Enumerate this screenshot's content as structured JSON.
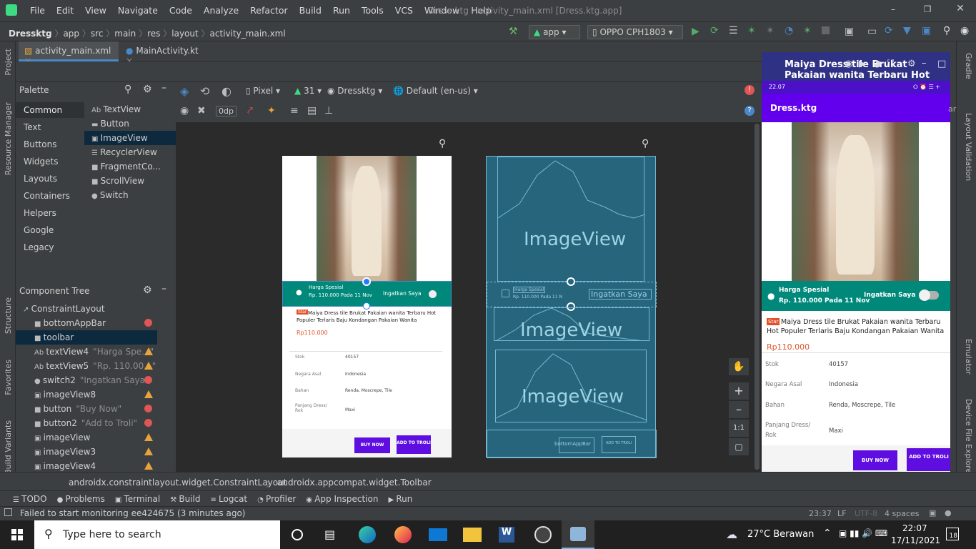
{
  "menu": [
    "File",
    "Edit",
    "View",
    "Navigate",
    "Code",
    "Analyze",
    "Refactor",
    "Build",
    "Run",
    "Tools",
    "VCS",
    "Window",
    "Help"
  ],
  "window_title": "Dress.ktg - activity_main.xml [Dress.ktg.app]",
  "breadcrumb": {
    "project": "Dressktg",
    "parts": [
      "app",
      "src",
      "main",
      "res",
      "layout"
    ],
    "file": "activity_main.xml"
  },
  "run_config": "app",
  "device": "OPPO CPH1803",
  "tabs": [
    {
      "label": "activity_main.xml"
    },
    {
      "label": "MainActivity.kt"
    }
  ],
  "left_strip": {
    "project": "Project",
    "resource_manager": "Resource Manager",
    "structure": "Structure",
    "favorites": "Favorites",
    "build_variants": "Build Variants"
  },
  "palette": {
    "title": "Palette",
    "categories": [
      "Common",
      "Text",
      "Buttons",
      "Widgets",
      "Layouts",
      "Containers",
      "Helpers",
      "Google",
      "Legacy"
    ],
    "items": [
      "TextView",
      "Button",
      "ImageView",
      "RecyclerView",
      "FragmentCo...",
      "ScrollView",
      "Switch"
    ]
  },
  "component_tree": {
    "title": "Component Tree",
    "items": [
      {
        "name": "ConstraintLayout",
        "sub": ""
      },
      {
        "name": "bottomAppBar",
        "sub": ""
      },
      {
        "name": "toolbar",
        "sub": ""
      },
      {
        "name": "textView4",
        "sub": "\"Harga Spe...\""
      },
      {
        "name": "textView5",
        "sub": "\"Rp. 110.00...\""
      },
      {
        "name": "switch2",
        "sub": "\"Ingatkan Saya\""
      },
      {
        "name": "imageView8",
        "sub": ""
      },
      {
        "name": "button",
        "sub": "\"Buy Now\""
      },
      {
        "name": "button2",
        "sub": "\"Add to Troli\""
      },
      {
        "name": "imageView",
        "sub": ""
      },
      {
        "name": "imageView3",
        "sub": ""
      },
      {
        "name": "imageView4",
        "sub": ""
      }
    ]
  },
  "design_toolbar": {
    "device": "Pixel",
    "api": "31",
    "theme": "Dressktg",
    "locale": "Default (en-us)",
    "margin": "0dp"
  },
  "design_preview": {
    "harga": "Harga Spesial",
    "price_short": "Rp. 110.000  Pada 11 Nov",
    "ingatkan": "Ingatkan Saya",
    "star": "Star",
    "title": "Maiya Dress tile Brukat Pakaian wanita Terbaru Hot Populer Terlaris Baju Kondangan Pakaian Wanita",
    "price": "Rp110.000",
    "specs": [
      {
        "k": "Stok",
        "v": "40157"
      },
      {
        "k": "Negara Asal",
        "v": "Indonesia"
      },
      {
        "k": "Bahan",
        "v": "Renda, Moscrepe, Tile"
      },
      {
        "k": "Panjang Dress/ Rok",
        "v": "Maxi"
      }
    ],
    "buy": "BUY NOW",
    "add": "ADD TO TROLI"
  },
  "blueprint": {
    "image_label": "ImageView",
    "harga": "Harga Spesial",
    "price": "Rp. 110.000  Pada 11 N",
    "ingatkan": "Ingatkan Saya",
    "bar": "bottomAppBar",
    "add": "ADD TO TROLI"
  },
  "emulator": {
    "title": "Maiya Dress tile Brukat Pakaian wanita Terbaru Hot Populer Terlaris Baju Kondangan Pakaian Wanita",
    "status_time": "22.07",
    "status_right": "⭘ ⏰ ☰ +",
    "app_title": "Dress.ktg",
    "harga": "Harga Spesial",
    "price_line": "Rp. 110.000   Pada 11 Nov",
    "ingatkan": "Ingatkan Saya",
    "star": "Star",
    "price": "Rp110.000",
    "specs": [
      {
        "k": "Stok",
        "v": "40157"
      },
      {
        "k": "Negara Asal",
        "v": "Indonesia"
      },
      {
        "k": "Bahan",
        "v": "Renda, Moscrepe, Tile"
      },
      {
        "k": "Panjang Dress/ Rok",
        "v": "Maxi"
      }
    ],
    "buy": "BUY NOW",
    "add": "ADD TO TROLI"
  },
  "right_strip": {
    "gradle": "Gradle",
    "layout_validation": "Layout Validation",
    "emulator": "Emulator",
    "device_explorer": "Device File Explorer",
    "partial": "ar"
  },
  "ide_status": {
    "path1": "androidx.constraintlayout.widget.ConstraintLayout",
    "path2": "androidx.appcompat.widget.Toolbar"
  },
  "tool_tabs": [
    "TODO",
    "Problems",
    "Terminal",
    "Build",
    "Logcat",
    "Profiler",
    "App Inspection",
    "Run"
  ],
  "message": "Failed to start monitoring ee424675 (3 minutes ago)",
  "status_right": {
    "pos": "23:37",
    "lf": "LF",
    "enc": "UTF-8",
    "indent": "4 spaces"
  },
  "taskbar": {
    "search": "Type here to search",
    "weather": "27°C  Berawan",
    "time": "22:07",
    "date": "17/11/2021",
    "notif": "18"
  },
  "colors": {
    "accent": "#4a88c7",
    "purple": "#5e0ee0",
    "teal": "#00897b",
    "emu_frame": "#2f3185"
  }
}
